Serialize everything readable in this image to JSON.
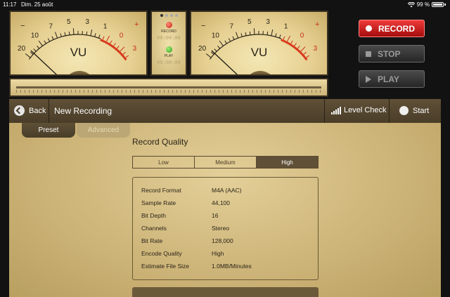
{
  "status_bar": {
    "time": "11:17",
    "date": "Dim. 25 août",
    "battery": "99 %"
  },
  "meters": {
    "scale": [
      "20",
      "10",
      "7",
      "5",
      "3",
      "1",
      "0",
      "3"
    ],
    "minus": "−",
    "plus": "+",
    "label": "VU",
    "needle_level": 0.05
  },
  "center_panel": {
    "record_label": "RECORD",
    "play_label": "PLAY",
    "record_time": "00:00:00",
    "play_time": "00:00:00"
  },
  "transport": {
    "record": "RECORD",
    "stop": "STOP",
    "play": "PLAY"
  },
  "nav": {
    "back": "Back",
    "title": "New Recording",
    "level_check": "Level Check",
    "start": "Start"
  },
  "tabs": {
    "preset": "Preset",
    "advanced": "Advanced"
  },
  "record_quality": {
    "title": "Record Quality",
    "options": [
      "Low",
      "Medium",
      "High"
    ],
    "selected": "High"
  },
  "info_rows": [
    {
      "label": "Record Format",
      "value": "M4A (AAC)"
    },
    {
      "label": "Sample Rate",
      "value": "44,100"
    },
    {
      "label": "Bit Depth",
      "value": "16"
    },
    {
      "label": "Channels",
      "value": "Stereo"
    },
    {
      "label": "Bit Rate",
      "value": "128,000"
    },
    {
      "label": "Encode Quality",
      "value": "High"
    },
    {
      "label": "Estimate File Size",
      "value": "1.0MB/Minutes"
    }
  ],
  "colors": {
    "record_red": "#d81818",
    "panel_brown": "#5f5037",
    "meter_cream": "#efe0ab"
  }
}
